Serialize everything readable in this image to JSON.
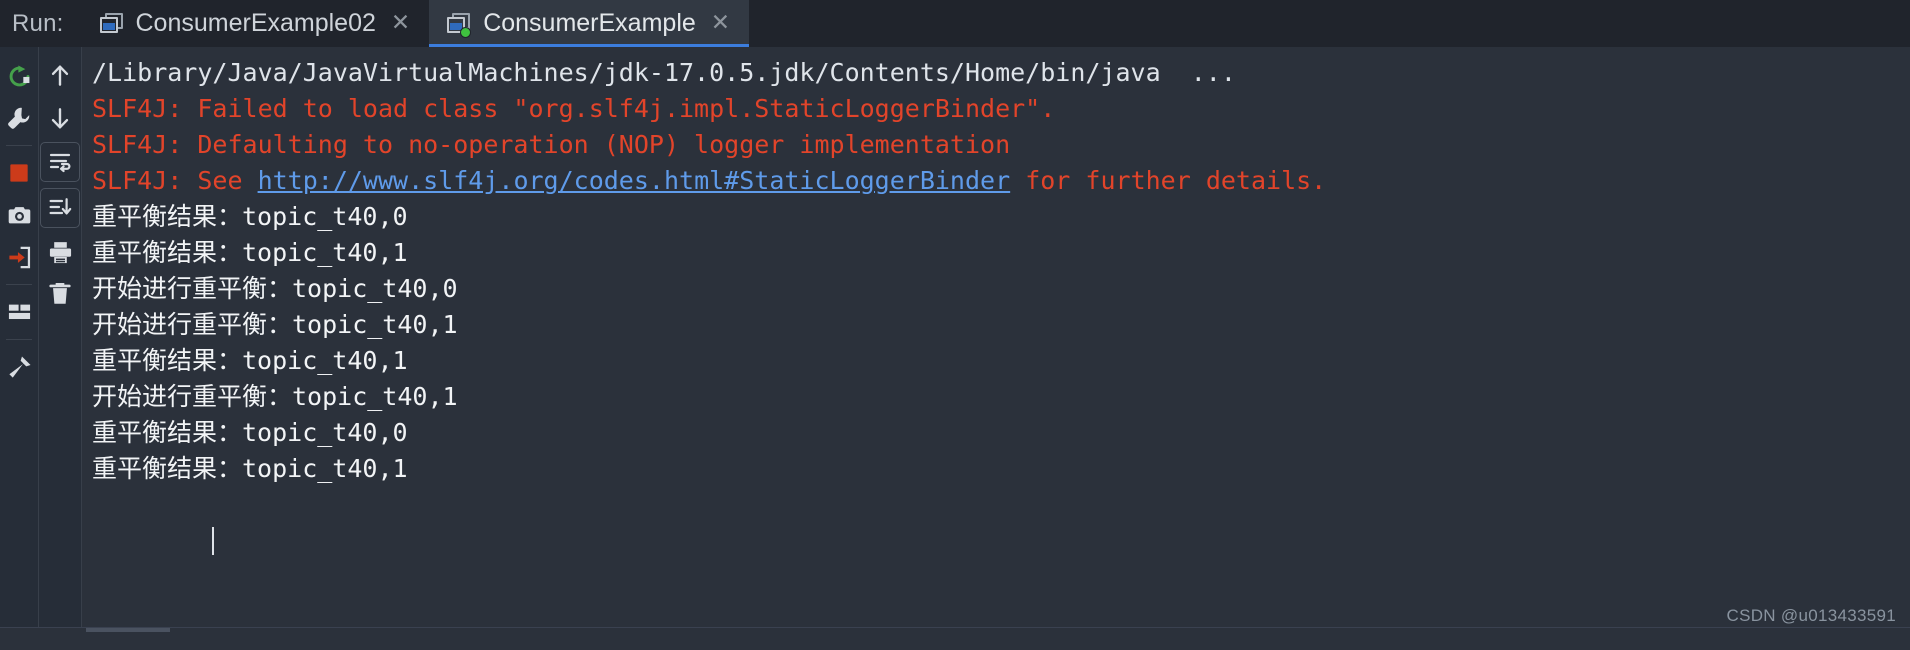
{
  "window": {
    "run_label": "Run:"
  },
  "tabs": [
    {
      "label": "ConsumerExample02",
      "active": false,
      "close_glyph": "✕",
      "icon": "run-config-icon",
      "has_running_dot": false
    },
    {
      "label": "ConsumerExample",
      "active": true,
      "close_glyph": "✕",
      "icon": "run-config-icon",
      "has_running_dot": true
    }
  ],
  "toolbar_left": [
    {
      "name": "rerun-icon",
      "title": "Rerun"
    },
    {
      "name": "wrench-icon",
      "title": "Edit Configuration"
    },
    {
      "name": "stop-icon",
      "title": "Stop"
    },
    {
      "name": "camera-icon",
      "title": "Capture Snapshot"
    },
    {
      "name": "export-icon",
      "title": "Dump Threads"
    },
    {
      "name": "layout-icon",
      "title": "Layout Settings"
    },
    {
      "name": "pin-icon",
      "title": "Pin Tab"
    }
  ],
  "toolbar_right": [
    {
      "name": "arrow-up-icon",
      "title": "Up the Stack Trace"
    },
    {
      "name": "arrow-down-icon",
      "title": "Down the Stack Trace"
    },
    {
      "name": "soft-wrap-icon",
      "title": "Soft-Wrap"
    },
    {
      "name": "scroll-end-icon",
      "title": "Scroll to the End"
    },
    {
      "name": "print-icon",
      "title": "Print"
    },
    {
      "name": "trash-icon",
      "title": "Clear All"
    }
  ],
  "console": {
    "lines": [
      {
        "type": "path",
        "segments": [
          {
            "text": "/Library/Java/JavaVirtualMachines/jdk-17.0.5.jdk/Contents/Home/bin/java  ...",
            "style": "path"
          }
        ]
      },
      {
        "type": "error",
        "segments": [
          {
            "text": "SLF4J: Failed to load class \"org.slf4j.impl.StaticLoggerBinder\".",
            "style": "err"
          }
        ]
      },
      {
        "type": "error",
        "segments": [
          {
            "text": "SLF4J: Defaulting to no-operation (NOP) logger implementation",
            "style": "err"
          }
        ]
      },
      {
        "type": "error-link",
        "segments": [
          {
            "text": "SLF4J: See ",
            "style": "err"
          },
          {
            "text": "http://www.slf4j.org/codes.html#StaticLoggerBinder",
            "style": "link"
          },
          {
            "text": " for further details.",
            "style": "err"
          }
        ]
      },
      {
        "type": "out",
        "segments": [
          {
            "text": "重平衡结果：topic_t40,0",
            "style": "cjk"
          }
        ]
      },
      {
        "type": "out",
        "segments": [
          {
            "text": "重平衡结果：topic_t40,1",
            "style": "cjk"
          }
        ]
      },
      {
        "type": "out",
        "segments": [
          {
            "text": "开始进行重平衡：topic_t40,0",
            "style": "cjk"
          }
        ]
      },
      {
        "type": "out",
        "segments": [
          {
            "text": "开始进行重平衡：topic_t40,1",
            "style": "cjk"
          }
        ]
      },
      {
        "type": "out",
        "segments": [
          {
            "text": "重平衡结果：topic_t40,1",
            "style": "cjk"
          }
        ]
      },
      {
        "type": "out",
        "segments": [
          {
            "text": "开始进行重平衡：topic_t40,1",
            "style": "cjk"
          }
        ]
      },
      {
        "type": "out",
        "segments": [
          {
            "text": "重平衡结果：topic_t40,0",
            "style": "cjk"
          }
        ]
      },
      {
        "type": "out",
        "segments": [
          {
            "text": "重平衡结果：topic_t40,1",
            "style": "cjk"
          }
        ]
      }
    ],
    "caret_visible": true
  },
  "watermark": "CSDN @u013433591",
  "colors": {
    "background": "#2b313b",
    "tabbar_background": "#20242c",
    "active_tab_background": "#323943",
    "active_tab_underline": "#3c7ddd",
    "error_text": "#e2442a",
    "link_text": "#5f9bea",
    "stdout_text": "#f2f4f6",
    "path_text": "#dfe4ea",
    "running_dot": "#3fc13f",
    "stop_button": "#cc3b1a",
    "rerun_arrow": "#45a04b"
  }
}
